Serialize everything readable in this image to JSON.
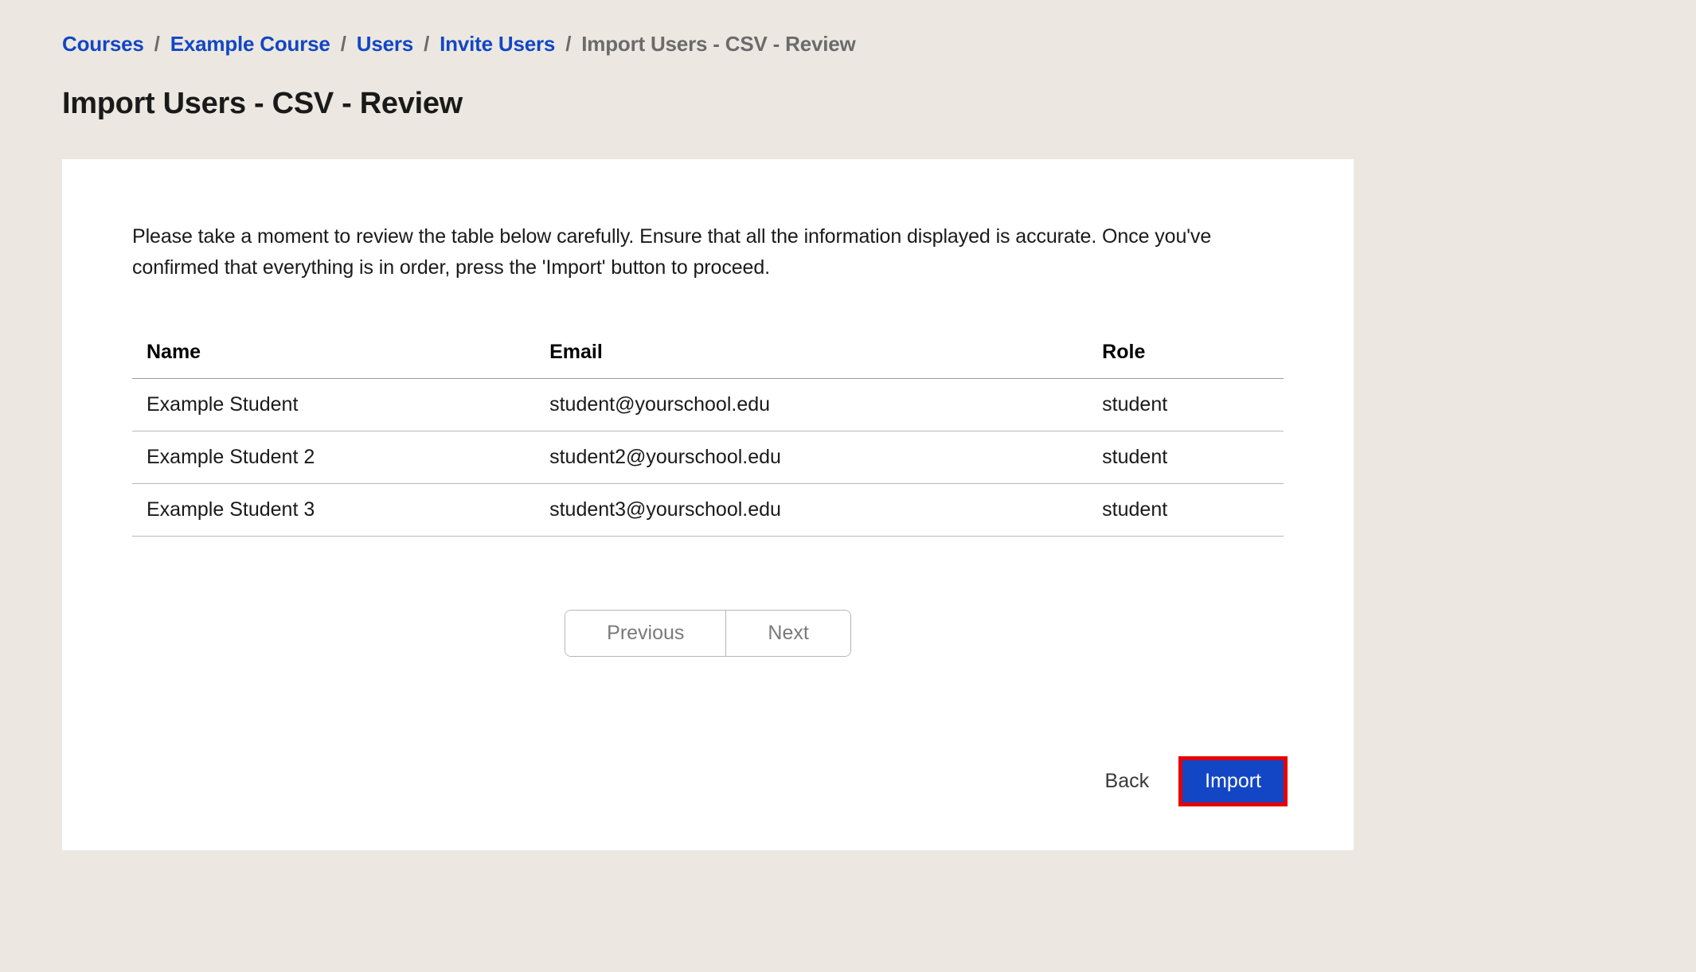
{
  "breadcrumb": {
    "items": [
      {
        "label": "Courses",
        "link": true
      },
      {
        "label": "Example Course",
        "link": true
      },
      {
        "label": "Users",
        "link": true
      },
      {
        "label": "Invite Users",
        "link": true
      },
      {
        "label": "Import Users - CSV - Review",
        "link": false
      }
    ],
    "separator": "/"
  },
  "page_title": "Import Users - CSV - Review",
  "card": {
    "intro": "Please take a moment to review the table below carefully. Ensure that all the information displayed is accurate. Once you've confirmed that everything is in order, press the 'Import' button to proceed.",
    "table": {
      "headers": {
        "name": "Name",
        "email": "Email",
        "role": "Role"
      },
      "rows": [
        {
          "name": "Example Student",
          "email": "student@yourschool.edu",
          "role": "student"
        },
        {
          "name": "Example Student 2",
          "email": "student2@yourschool.edu",
          "role": "student"
        },
        {
          "name": "Example Student 3",
          "email": "student3@yourschool.edu",
          "role": "student"
        }
      ]
    },
    "paginate": {
      "prev": "Previous",
      "next": "Next"
    },
    "footer": {
      "back": "Back",
      "import": "Import"
    }
  },
  "colors": {
    "accent": "#1246c4",
    "highlight_outline": "#e60000",
    "page_bg": "#ece8e1"
  }
}
